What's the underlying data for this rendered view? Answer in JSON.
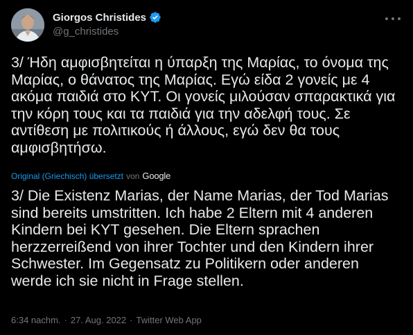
{
  "author": {
    "display_name": "Giorgos Christides",
    "handle": "@g_christides",
    "verified_icon": "verified-badge-icon",
    "avatar": "profile-photo"
  },
  "tweet": {
    "text_original": "3/ Ήδη αμφισβητείται η ύπαρξη της Μαρίας, το όνομα της Μαρίας, ο θάνατος της Μαρίας. Εγώ είδα 2 γονείς με 4 ακόμα παιδιά στο ΚΥΤ. Οι γονείς μιλούσαν σπαρακτικά για την κόρη τους και τα παιδιά για την αδελφή τους. Σε αντίθεση με πολιτικούς ή άλλους, εγώ δεν θα τους αμφισβητήσω.",
    "translation_link": "Original (Griechisch) übersetzt",
    "translation_by": "von",
    "translation_provider": "Google",
    "text_translated": "3/ Die Existenz Marias, der Name Marias, der Tod Marias sind bereits umstritten. Ich habe 2 Eltern mit 4 anderen Kindern bei KYT gesehen. Die Eltern sprachen herzzerreißend von ihrer Tochter und den Kindern ihrer Schwester. Im Gegensatz zu Politikern oder anderen werde ich sie nicht in Frage stellen."
  },
  "meta": {
    "time": "6:34 nachm.",
    "separator": "·",
    "date": "27. Aug. 2022",
    "source": "Twitter Web App"
  },
  "colors": {
    "background": "#000000",
    "text": "#e7e9ea",
    "secondary": "#71767b",
    "accent": "#1d9bf0"
  }
}
